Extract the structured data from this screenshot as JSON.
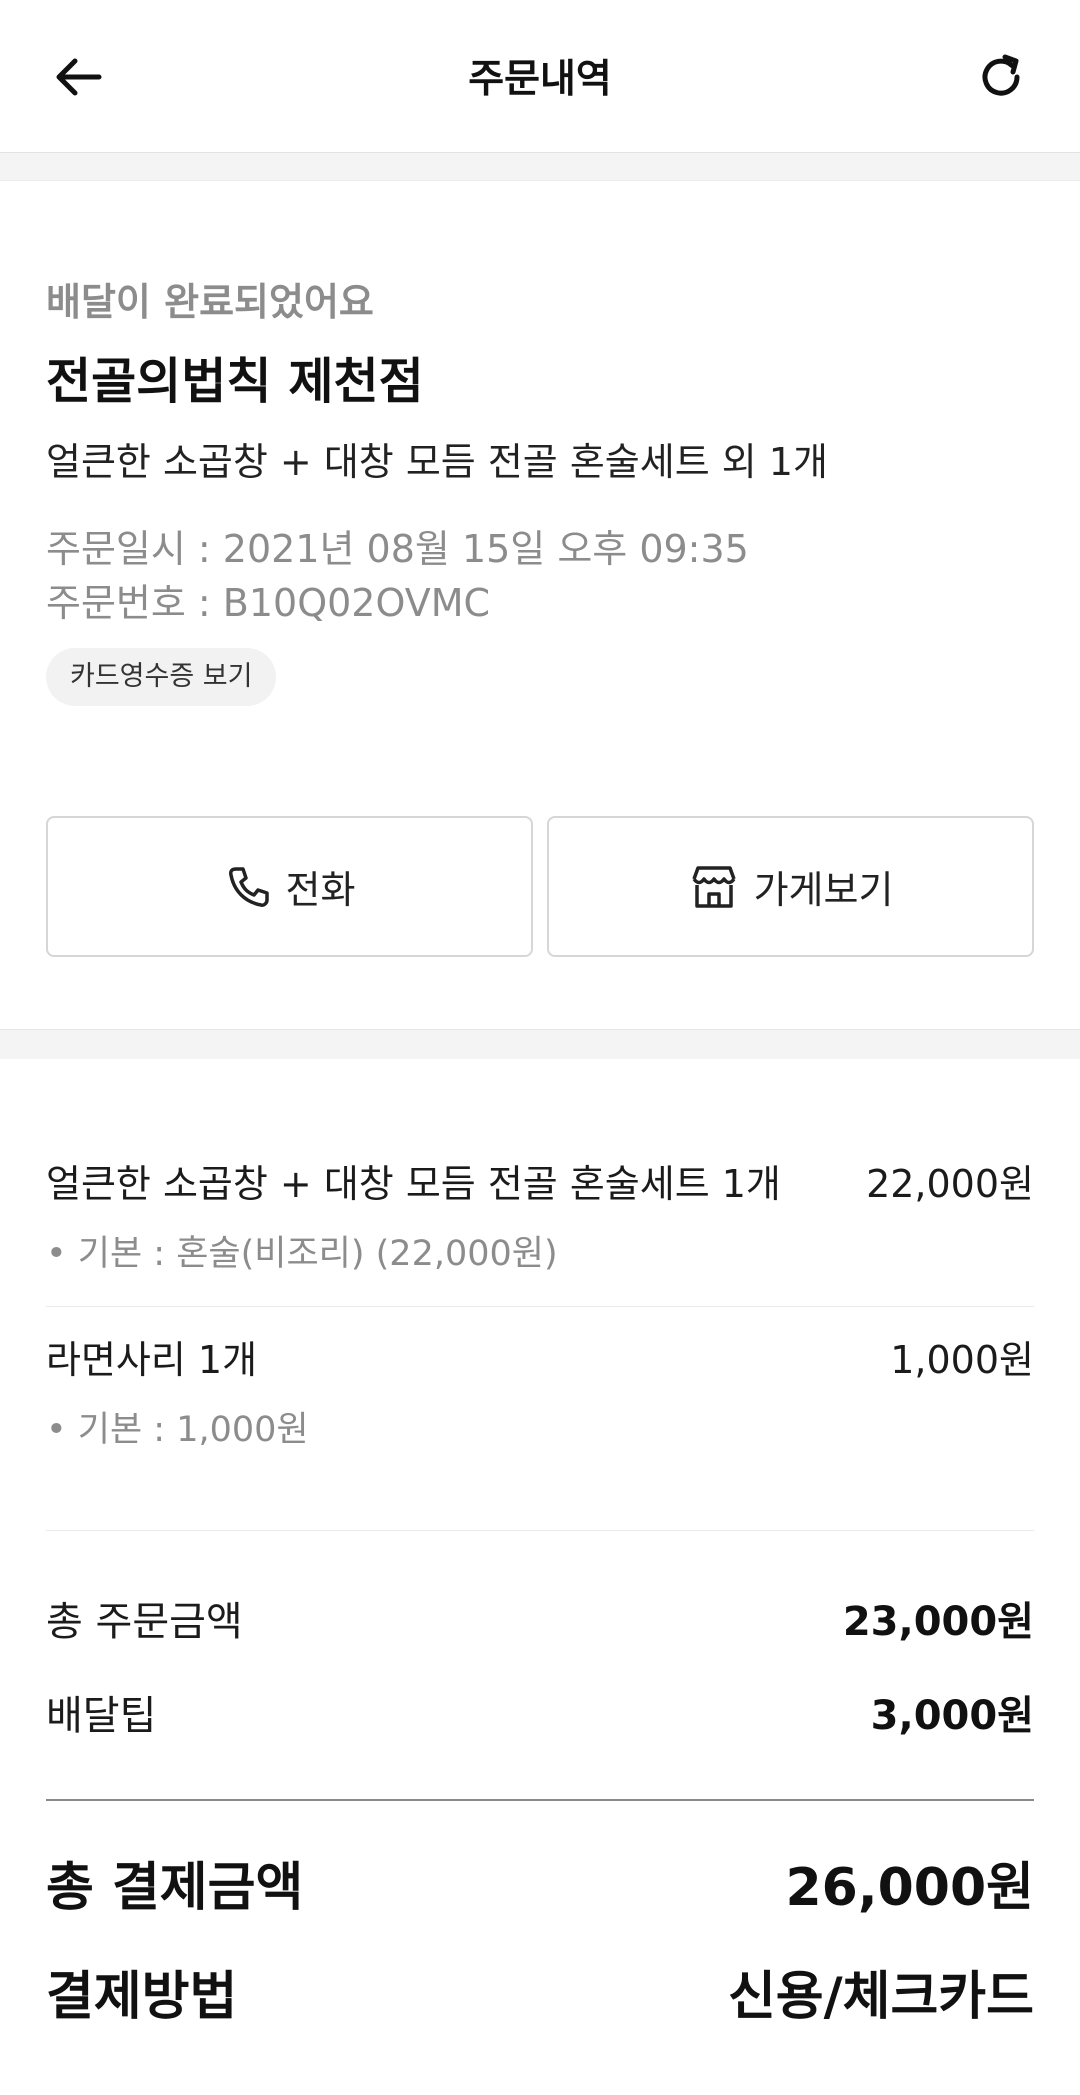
{
  "header": {
    "title": "주문내역",
    "back_icon": "arrow-left-icon",
    "refresh_icon": "refresh-icon"
  },
  "order": {
    "status": "배달이 완료되었어요",
    "store_name": "전골의법칙 제천점",
    "menu_summary": "얼큰한 소곱창 + 대창 모듬 전골 혼술세트 외 1개",
    "order_datetime": "주문일시 : 2021년 08월 15일 오후 09:35",
    "order_number": "주문번호 : B10Q02OVMC",
    "receipt_label": "카드영수증 보기"
  },
  "actions": {
    "call_label": "전화",
    "store_label": "가게보기"
  },
  "items": [
    {
      "name": "얼큰한 소곱창 + 대창 모듬 전골 혼술세트 1개",
      "price": "22,000원",
      "option": "• 기본 : 혼술(비조리) (22,000원)"
    },
    {
      "name": "라면사리 1개",
      "price": "1,000원",
      "option": "• 기본 : 1,000원"
    }
  ],
  "totals": {
    "order_total_label": "총 주문금액",
    "order_total_value": "23,000원",
    "delivery_tip_label": "배달팁",
    "delivery_tip_value": "3,000원"
  },
  "payment": {
    "total_label": "총 결제금액",
    "total_value": "26,000원",
    "method_label": "결제방법",
    "method_value": "신용/체크카드"
  }
}
